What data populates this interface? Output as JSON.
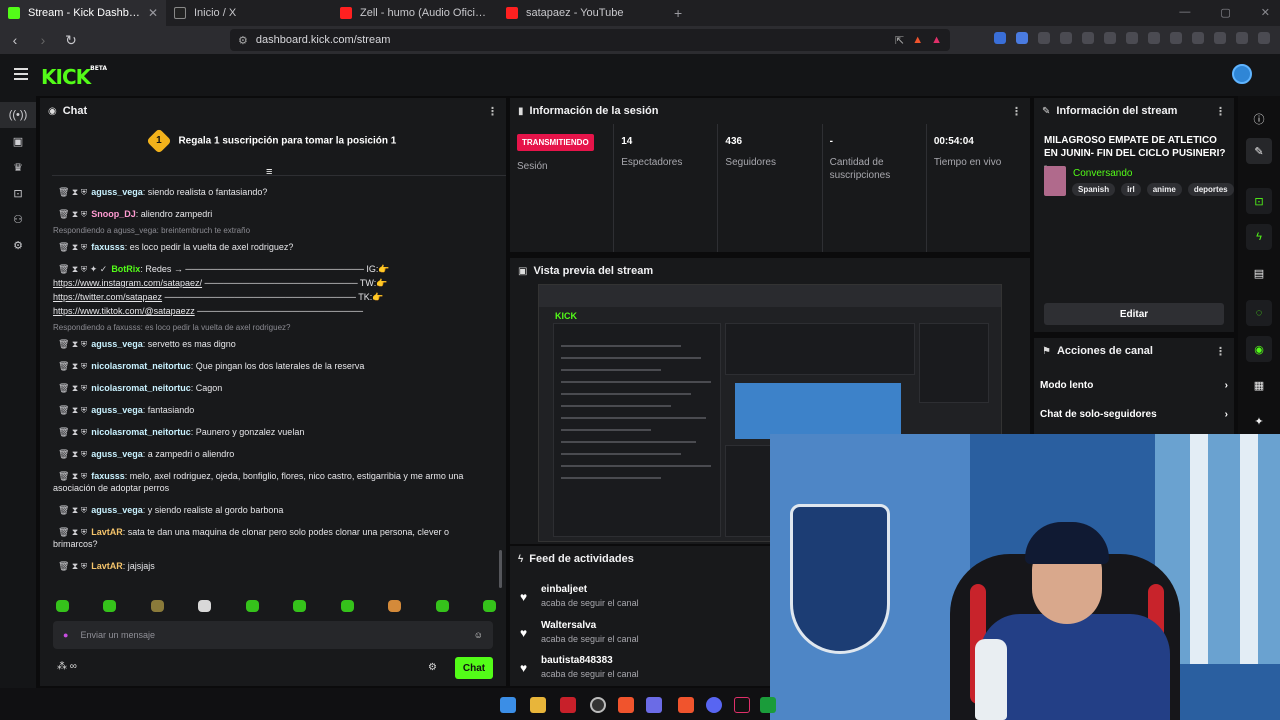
{
  "browser": {
    "tabs": [
      {
        "title": "Stream - Kick Dashboard",
        "color": "#53fc18",
        "active": true
      },
      {
        "title": "Inicio / X",
        "color": "#222222",
        "active": false
      },
      {
        "title": "Zell - humo (Audio Oficial) - YouTube",
        "color": "#ff2020",
        "active": false
      },
      {
        "title": "satapaez - YouTube",
        "color": "#ff2020",
        "active": false
      }
    ],
    "url": "dashboard.kick.com/stream"
  },
  "header": {
    "logo": "KICK",
    "logo_badge": "BETA"
  },
  "chat": {
    "title": "Chat",
    "gift_level": "1",
    "gift_text": "Regala 1 suscripción para tomar la posición 1",
    "messages": [
      {
        "user": "aguss_vega",
        "color": "#c9f2ff",
        "text": ": siendo realista o fantasiando?"
      },
      {
        "user": "Snoop_DJ",
        "color": "#ff9bd2",
        "text": ": aliendro zampedri"
      },
      {
        "reply": "Respondiendo a aguss_vega: breintembruch te extraño"
      },
      {
        "user": "faxusss",
        "color": "#c9f2ff",
        "text": ": es loco pedir la vuelta de axel rodriguez?"
      },
      {
        "user": "BotRix",
        "color": "#53fc18",
        "text": ": Redes → ──────────────────────────── IG:👉",
        "bot": true
      },
      {
        "link": "https://www.instagram.com/satapaez/",
        "tail": " ──────────────────────── TW:👉"
      },
      {
        "link": "https://twitter.com/satapaez",
        "tail": " ────────────────────────────── TK:👉"
      },
      {
        "link": "https://www.tiktok.com/@satapaezz",
        "tail": " ──────────────────────────"
      },
      {
        "reply": "Respondiendo a faxusss: es loco pedir la vuelta de axel rodriguez?"
      },
      {
        "user": "aguss_vega",
        "color": "#c9f2ff",
        "text": ": servetto es mas digno"
      },
      {
        "user": "nicolasromat_neitortuc",
        "color": "#c9f2ff",
        "text": ": Que pingan los dos laterales de la reserva"
      },
      {
        "user": "nicolasromat_neitortuc",
        "color": "#c9f2ff",
        "text": ": Cagon"
      },
      {
        "user": "aguss_vega",
        "color": "#c9f2ff",
        "text": ": fantasiando"
      },
      {
        "user": "nicolasromat_neitortuc",
        "color": "#c9f2ff",
        "text": ": Paunero y gonzalez vuelan"
      },
      {
        "user": "aguss_vega",
        "color": "#c9f2ff",
        "text": ": a zampedri o aliendro"
      },
      {
        "user": "faxusss",
        "color": "#c9f2ff",
        "text": ": melo, axel rodriguez, ojeda, bonfiglio, flores, nico castro, estigarribia y me armo una asociación de adoptar perros"
      },
      {
        "user": "aguss_vega",
        "color": "#c9f2ff",
        "text": ": y siendo realiste al gordo barbona"
      },
      {
        "user": "LavtAR",
        "color": "#f5c46b",
        "text": ": sata te dan una maquina de clonar pero solo podes clonar una persona, clever o brimarcos?"
      },
      {
        "user": "LavtAR",
        "color": "#f5c46b",
        "text": ": jajsjajs"
      }
    ],
    "input_placeholder": "Enviar un mensaje",
    "points_label": "∞",
    "send_label": "Chat"
  },
  "session": {
    "title": "Información de la sesión",
    "live_badge": "TRANSMITIENDO",
    "session_label": "Sesión",
    "stats": [
      {
        "value": "14",
        "label": "Espectadores"
      },
      {
        "value": "436",
        "label": "Seguidores"
      },
      {
        "value": "-",
        "label": "Cantidad de suscripciones"
      },
      {
        "value": "00:54:04",
        "label": "Tiempo en vivo"
      }
    ]
  },
  "stream_info": {
    "title": "Información del stream",
    "stream_title": "MILAGROSO EMPATE DE ATLETICO EN JUNIN- FIN DEL CICLO PUSINERI? -...",
    "category": "Conversando",
    "tags": [
      "Spanish",
      "irl",
      "anime",
      "deportes"
    ],
    "edit_label": "Editar"
  },
  "channel_actions": {
    "title": "Acciones de canal",
    "items": [
      "Modo lento",
      "Chat de solo-seguidores"
    ]
  },
  "preview": {
    "title": "Vista previa del stream"
  },
  "feed": {
    "title": "Feed de actividades",
    "items": [
      {
        "name": "einbaljeet",
        "sub": "acaba de seguir el canal"
      },
      {
        "name": "Waltersalva",
        "sub": "acaba de seguir el canal"
      },
      {
        "name": "bautista848383",
        "sub": "acaba de seguir el canal"
      }
    ]
  },
  "colors": {
    "accent": "#53fc18",
    "live": "#e6144a"
  }
}
